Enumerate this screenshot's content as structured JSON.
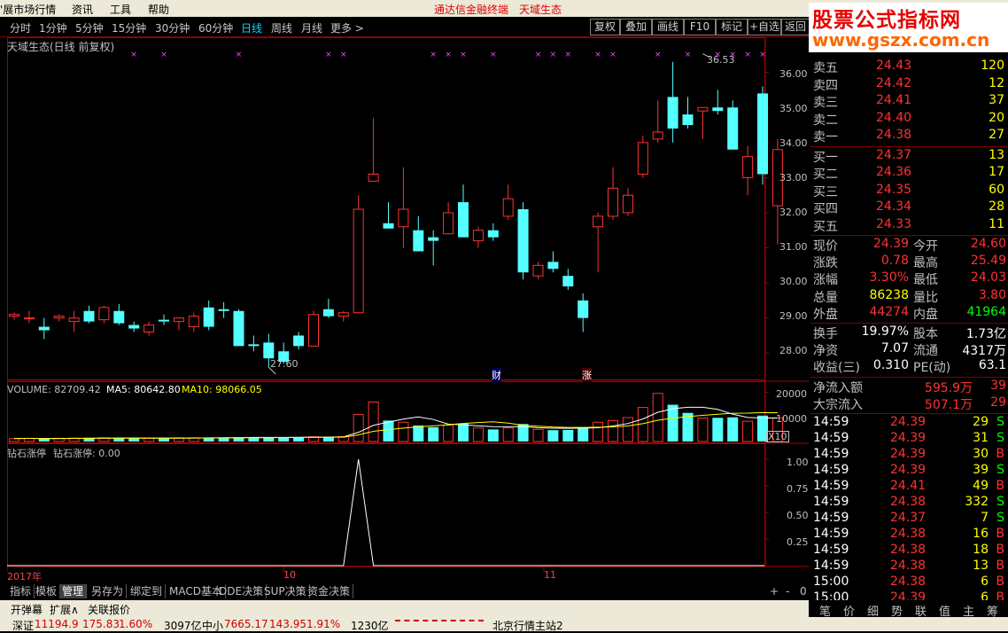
{
  "menu": {
    "items": [
      "'展市场行情",
      "资讯",
      "工具",
      "帮助"
    ],
    "title_left": "通达信金融终端",
    "title_right": "天域生态"
  },
  "logo": {
    "line1": "股票公式指标网",
    "line2": "www.gszx.com.cn"
  },
  "periods": {
    "items": [
      "分时",
      "1分钟",
      "5分钟",
      "15分钟",
      "30分钟",
      "60分钟",
      "日线",
      "周线",
      "月线",
      "更多 >"
    ],
    "active": "日线"
  },
  "toolbar": {
    "buttons": [
      "复权",
      "叠加",
      "画线",
      "F10",
      "标记",
      "+自选",
      "返回"
    ]
  },
  "chart": {
    "title": "天域生态(日线 前复权)",
    "high_label": "36.53",
    "low_label": "27.60",
    "event_labels": [
      "财",
      "涨"
    ],
    "price_axis": [
      "36.00",
      "35.00",
      "34.00",
      "33.00",
      "32.00",
      "31.00",
      "30.00",
      "29.00",
      "28.00"
    ],
    "volume_title": "VOLUME: 82709.42",
    "ma5": "MA5: 80642.80",
    "ma10": "MA10: 98066.05",
    "volume_axis": [
      "20000",
      "10000"
    ],
    "volume_unit": "X10",
    "indicator_name": "钻石涨停",
    "indicator_title": "钻石涨停: 0.00",
    "indicator_axis": [
      "1.00",
      "0.75",
      "0.50",
      "0.25"
    ],
    "date_labels": [
      "2017年",
      "10",
      "11"
    ]
  },
  "chart_data": {
    "type": "candlestick",
    "series": [
      {
        "name": "price",
        "ohlc": [
          [
            29.05,
            29.15,
            28.95,
            29.1
          ],
          [
            29.0,
            29.2,
            28.85,
            29.0
          ],
          [
            28.75,
            29.0,
            28.4,
            28.65
          ],
          [
            29.0,
            29.1,
            28.9,
            29.05
          ],
          [
            28.9,
            29.2,
            28.6,
            29.0
          ],
          [
            29.2,
            29.35,
            28.85,
            28.9
          ],
          [
            28.95,
            29.35,
            28.85,
            29.3
          ],
          [
            29.2,
            29.4,
            28.8,
            28.85
          ],
          [
            28.8,
            28.9,
            28.6,
            28.7
          ],
          [
            28.6,
            28.9,
            28.5,
            28.8
          ],
          [
            28.95,
            29.1,
            28.8,
            28.9
          ],
          [
            28.9,
            29.0,
            28.65,
            29.0
          ],
          [
            28.75,
            29.15,
            28.6,
            29.05
          ],
          [
            29.3,
            29.5,
            28.65,
            28.75
          ],
          [
            29.25,
            29.45,
            29.0,
            29.2
          ],
          [
            29.2,
            29.25,
            28.2,
            28.2
          ],
          [
            28.25,
            28.5,
            28.05,
            28.2
          ],
          [
            28.3,
            28.55,
            27.6,
            27.85
          ],
          [
            28.05,
            28.3,
            27.7,
            27.75
          ],
          [
            28.5,
            28.6,
            28.1,
            28.2
          ],
          [
            28.2,
            29.2,
            28.2,
            29.1
          ],
          [
            29.25,
            29.55,
            29.0,
            29.05
          ],
          [
            29.05,
            29.2,
            28.9,
            29.15
          ],
          [
            29.15,
            32.5,
            29.15,
            32.1
          ],
          [
            32.9,
            34.7,
            32.9,
            33.1
          ],
          [
            31.7,
            32.3,
            31.55,
            31.55
          ],
          [
            31.6,
            33.3,
            31.0,
            32.1
          ],
          [
            31.5,
            31.9,
            30.9,
            30.9
          ],
          [
            31.3,
            31.5,
            30.5,
            31.2
          ],
          [
            31.4,
            32.3,
            31.4,
            32.0
          ],
          [
            32.3,
            32.8,
            31.5,
            31.3
          ],
          [
            31.2,
            31.6,
            31.0,
            31.5
          ],
          [
            31.5,
            31.7,
            31.2,
            31.3
          ],
          [
            31.9,
            32.8,
            31.8,
            32.4
          ],
          [
            32.1,
            32.3,
            30.1,
            30.3
          ],
          [
            30.2,
            30.6,
            30.1,
            30.5
          ],
          [
            30.6,
            30.9,
            30.3,
            30.4
          ],
          [
            30.2,
            30.4,
            29.8,
            29.9
          ],
          [
            29.5,
            29.7,
            28.6,
            29.0
          ],
          [
            31.6,
            32.0,
            30.3,
            31.9
          ],
          [
            31.9,
            33.3,
            31.8,
            32.7
          ],
          [
            32.0,
            32.7,
            31.9,
            32.5
          ],
          [
            33.1,
            34.2,
            33.0,
            34.0
          ],
          [
            34.1,
            35.2,
            34.0,
            34.3
          ],
          [
            35.3,
            36.3,
            34.0,
            34.4
          ],
          [
            34.8,
            35.3,
            34.4,
            34.5
          ],
          [
            34.9,
            35.0,
            34.1,
            35.0
          ],
          [
            35.0,
            35.5,
            34.8,
            34.9
          ],
          [
            35.0,
            35.2,
            33.8,
            33.8
          ],
          [
            33.0,
            33.9,
            32.5,
            33.6
          ],
          [
            35.4,
            35.6,
            32.8,
            33.1
          ],
          [
            32.2,
            34.1,
            31.1,
            33.8
          ]
        ]
      },
      {
        "name": "volume",
        "values": [
          1200,
          1300,
          1100,
          1300,
          1400,
          1500,
          1500,
          1400,
          1300,
          1300,
          1400,
          1500,
          1500,
          1600,
          1600,
          1700,
          1800,
          1600,
          1700,
          1800,
          1900,
          1900,
          2000,
          11000,
          16000,
          8500,
          7800,
          6500,
          5800,
          6600,
          7300,
          5500,
          4900,
          5500,
          7100,
          4900,
          4600,
          4700,
          5800,
          7800,
          8500,
          9700,
          13800,
          19500,
          14900,
          11600,
          9500,
          9600,
          9800,
          8200,
          10500,
          9600
        ]
      }
    ],
    "ylim": [
      27.4,
      36.8
    ],
    "volume_ylim": [
      0,
      23000
    ]
  },
  "quote": {
    "sell": [
      {
        "label": "卖五",
        "price": "24.43",
        "vol": "120"
      },
      {
        "label": "卖四",
        "price": "24.42",
        "vol": "12"
      },
      {
        "label": "卖三",
        "price": "24.41",
        "vol": "37"
      },
      {
        "label": "卖二",
        "price": "24.40",
        "vol": "20"
      },
      {
        "label": "卖一",
        "price": "24.38",
        "vol": "27"
      }
    ],
    "buy": [
      {
        "label": "买一",
        "price": "24.37",
        "vol": "13"
      },
      {
        "label": "买二",
        "price": "24.36",
        "vol": "17"
      },
      {
        "label": "买三",
        "price": "24.35",
        "vol": "60"
      },
      {
        "label": "买四",
        "price": "24.34",
        "vol": "28"
      },
      {
        "label": "买五",
        "price": "24.33",
        "vol": "11"
      }
    ],
    "stats": [
      {
        "l1": "现价",
        "v1": "24.39",
        "l2": "今开",
        "v2": "24.60"
      },
      {
        "l1": "涨跌",
        "v1": "0.78",
        "l2": "最高",
        "v2": "25.49"
      },
      {
        "l1": "涨幅",
        "v1": "3.30%",
        "l2": "最低",
        "v2": "24.03"
      },
      {
        "l1": "总量",
        "v1": "86238",
        "l2": "量比",
        "v2": "3.80"
      },
      {
        "l1": "外盘",
        "v1": "44274",
        "l2": "内盘",
        "v2": "41964"
      }
    ],
    "stats2": [
      {
        "l1": "换手",
        "v1": "19.97%",
        "l2": "股本",
        "v2": "1.73亿"
      },
      {
        "l1": "净资",
        "v1": "7.07",
        "l2": "流通",
        "v2": "4317万"
      },
      {
        "l1": "收益(三)",
        "v1": "0.310",
        "l2": "PE(动)",
        "v2": "63.1"
      }
    ],
    "flow": [
      {
        "l": "净流入额",
        "v": "595.9万",
        "p": "39"
      },
      {
        "l": "大宗流入",
        "v": "507.1万",
        "p": "29"
      }
    ],
    "ticks": [
      {
        "t": "14:59",
        "p": "24.39",
        "v": "29",
        "f": "S"
      },
      {
        "t": "14:59",
        "p": "24.39",
        "v": "31",
        "f": "S"
      },
      {
        "t": "14:59",
        "p": "24.39",
        "v": "30",
        "f": "B"
      },
      {
        "t": "14:59",
        "p": "24.39",
        "v": "39",
        "f": "S"
      },
      {
        "t": "14:59",
        "p": "24.41",
        "v": "49",
        "f": "B"
      },
      {
        "t": "14:59",
        "p": "24.38",
        "v": "332",
        "f": "S"
      },
      {
        "t": "14:59",
        "p": "24.37",
        "v": "7",
        "f": "S"
      },
      {
        "t": "14:59",
        "p": "24.38",
        "v": "16",
        "f": "B"
      },
      {
        "t": "14:59",
        "p": "24.38",
        "v": "18",
        "f": "B"
      },
      {
        "t": "14:59",
        "p": "24.38",
        "v": "13",
        "f": "B"
      },
      {
        "t": "15:00",
        "p": "24.38",
        "v": "6",
        "f": "B"
      },
      {
        "t": "15:00",
        "p": "24.39",
        "v": "6",
        "f": "B"
      }
    ]
  },
  "tabs": {
    "items": [
      "指标",
      "模板",
      "管理",
      "另存为",
      "绑定到",
      "MACD基本",
      "DDE决策",
      "SUP决策",
      "资金决策"
    ],
    "active": "管理",
    "extra": [
      "+",
      "-",
      "0"
    ]
  },
  "toolbar2": {
    "items": [
      "开弹幕",
      "扩展∧",
      "关联报价"
    ]
  },
  "right_tabs": [
    "笔",
    "价",
    "细",
    "势",
    "联",
    "值",
    "主",
    "筹"
  ],
  "status": {
    "sz_label": "深证",
    "sz_value": "11194.9",
    "sz_change": "175.83",
    "sz_pct": "1.60%",
    "sz_amount": "3097亿",
    "zx_label": "中小",
    "zx_value": "7665.17",
    "zx_change": "143.95",
    "zx_pct": "1.91%",
    "zx_amount": "1230亿",
    "server": "北京行情主站2"
  },
  "colors": {
    "up": "#ff3232",
    "down": "#54ffff",
    "axis": "#a00000",
    "ma5": "#ffffff",
    "ma10": "#ffff00"
  }
}
